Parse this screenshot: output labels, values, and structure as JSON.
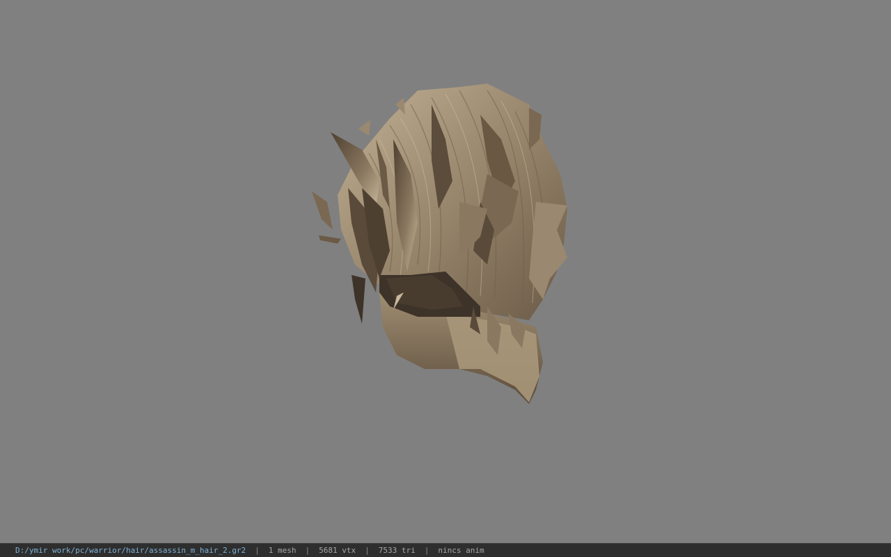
{
  "viewport": {
    "background": "#808080",
    "model": "hair-mesh",
    "hair_colors": {
      "light": "#b5a48a",
      "mid": "#8e7d66",
      "dark": "#5a4a3a",
      "band": "#3e3328"
    }
  },
  "statusbar": {
    "path": "D:/ymir work/pc/warrior/hair/assassin_m_hair_2.gr2",
    "separator": "|",
    "mesh": "1 mesh",
    "vtx": "5681 vtx",
    "tri": "7533 tri",
    "anim": "nincs anim"
  }
}
